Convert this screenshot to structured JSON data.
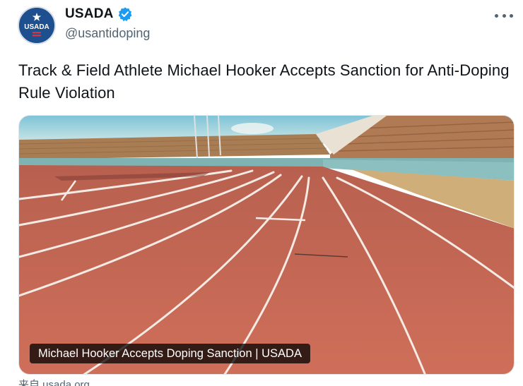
{
  "account": {
    "display_name": "USADA",
    "handle": "@usantidoping",
    "avatar_text": "USADA",
    "verified": true
  },
  "tweet": {
    "text": "Track & Field Athlete Michael Hooker Accepts Sanction for Anti-Doping Rule Violation"
  },
  "media": {
    "caption": "Michael Hooker Accepts Doping Sanction | USADA",
    "source": "来自 usada.org"
  },
  "icons": {
    "more": "more-options-icon",
    "verified": "verified-badge-icon"
  },
  "colors": {
    "verified_blue": "#1d9bf0",
    "text": "#0f1419",
    "secondary_text": "#536471",
    "avatar_bg": "#1e4f8e",
    "track": "#c96a55"
  }
}
